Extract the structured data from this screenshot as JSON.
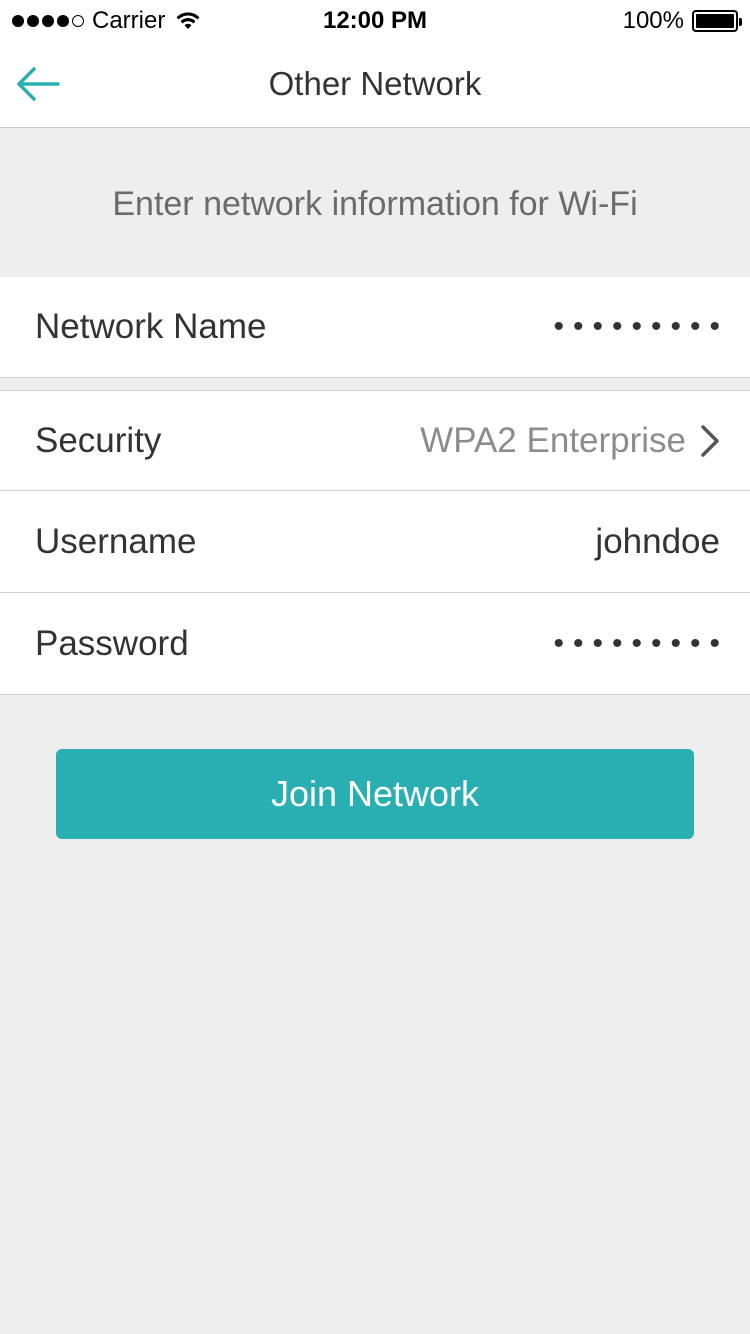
{
  "status_bar": {
    "carrier": "Carrier",
    "time": "12:00 PM",
    "battery": "100%",
    "signal_bars_filled": 4,
    "signal_bars_total": 5
  },
  "nav": {
    "title": "Other Network",
    "back_icon": "arrow-left-icon"
  },
  "subtitle": "Enter network information for Wi-Fi",
  "form": {
    "network_name": {
      "label": "Network Name",
      "value": "•••••••••"
    },
    "security": {
      "label": "Security",
      "value": "WPA2 Enterprise",
      "icon": "chevron-right-icon"
    },
    "username": {
      "label": "Username",
      "value": "johndoe"
    },
    "password": {
      "label": "Password",
      "value": "•••••••••"
    }
  },
  "join_button": {
    "label": "Join Network"
  },
  "colors": {
    "accent": "#29afb2",
    "background": "#eeeeee",
    "text": "#333333",
    "muted_text": "#8c8c8c"
  }
}
